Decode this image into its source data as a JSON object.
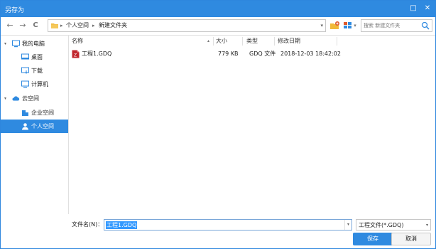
{
  "window": {
    "title": "另存为",
    "maximize_glyph": "□",
    "close_glyph": "✕"
  },
  "toolbar": {
    "back_glyph": "←",
    "forward_glyph": "→",
    "refresh_glyph": "C",
    "breadcrumb": [
      "个人空间",
      "新建文件夹"
    ],
    "breadcrumb_sep": "▸",
    "address_dropdown": "▾",
    "view_dropdown": "▾",
    "search_placeholder": "搜索 新建文件夹"
  },
  "sidebar": {
    "items": [
      {
        "label": "我的电脑",
        "icon": "computer-icon",
        "arrow": "▾"
      },
      {
        "label": "桌面",
        "icon": "desktop-icon"
      },
      {
        "label": "下载",
        "icon": "download-icon"
      },
      {
        "label": "计算机",
        "icon": "monitor-icon"
      },
      {
        "label": "云空间",
        "icon": "cloud-icon",
        "arrow": "▾"
      },
      {
        "label": "企业空间",
        "icon": "enterprise-icon"
      },
      {
        "label": "个人空间",
        "icon": "person-icon",
        "selected": true
      }
    ]
  },
  "filelist": {
    "columns": [
      "名称",
      "大小",
      "类型",
      "修改日期"
    ],
    "sort_glyph": "▴",
    "rows": [
      {
        "name": "工程1.GDQ",
        "size": "779 KB",
        "type": "GDQ 文件",
        "modified": "2018-12-03 18:42:02",
        "icon": "gdq-file-icon"
      }
    ]
  },
  "footer": {
    "filename_label": "文件名(N)：",
    "filename_value": "工程1.GDQ",
    "filetype_value": "工程文件(*.GDQ)",
    "dropdown_glyph": "▾",
    "save_label": "保存",
    "cancel_label": "取消"
  },
  "colors": {
    "accent": "#2f8ae0",
    "selection": "#3399ff",
    "file_icon_red": "#c0262d",
    "folder_yellow": "#f0b93a"
  }
}
